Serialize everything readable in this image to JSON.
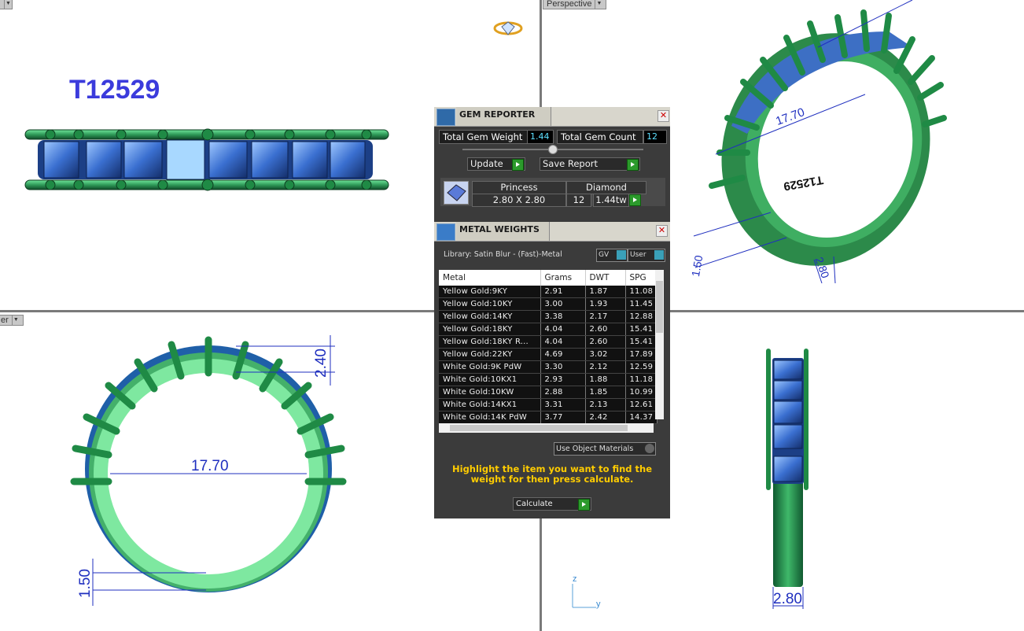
{
  "scene": {
    "model_code": "T12529",
    "perspective_label": "Perspective",
    "left_view_label": "er",
    "dimensions": {
      "d_2_40": "2.40",
      "d_17_70": "17.70",
      "d_1_50": "1.50",
      "d_2_80": "2.80",
      "d_2_80_side": "2.80",
      "d_17_70_persp": "17.70",
      "d_1_50_persp": "1.50",
      "d_code_mirror": "T12529"
    },
    "axis": {
      "z": "z",
      "y": "y"
    }
  },
  "gem_reporter": {
    "title": "GEM REPORTER",
    "total_weight_label": "Total Gem Weight",
    "total_weight_value": "1.44",
    "total_count_label": "Total Gem Count",
    "total_count_value": "12",
    "update_label": "Update",
    "save_report_label": "Save Report",
    "gem": {
      "shape": "Princess",
      "size": "2.80 X 2.80",
      "material": "Diamond",
      "count": "12",
      "weight": "1.44tw"
    }
  },
  "metal_weights": {
    "title": "METAL WEIGHTS",
    "library": "Library: Satin Blur - (Fast)-Metal",
    "toggle_gv": "GV",
    "toggle_user": "User",
    "columns": [
      "Metal",
      "Grams",
      "DWT",
      "SPG"
    ],
    "rows": [
      [
        "Yellow Gold:9KY",
        "2.91",
        "1.87",
        "11.08"
      ],
      [
        "Yellow Gold:10KY",
        "3.00",
        "1.93",
        "11.45"
      ],
      [
        "Yellow Gold:14KY",
        "3.38",
        "2.17",
        "12.88"
      ],
      [
        "Yellow Gold:18KY",
        "4.04",
        "2.60",
        "15.41"
      ],
      [
        "Yellow Gold:18KY R...",
        "4.04",
        "2.60",
        "15.41"
      ],
      [
        "Yellow Gold:22KY",
        "4.69",
        "3.02",
        "17.89"
      ],
      [
        "White Gold:9K PdW",
        "3.30",
        "2.12",
        "12.59"
      ],
      [
        "White Gold:10KX1",
        "2.93",
        "1.88",
        "11.18"
      ],
      [
        "White Gold:10KW",
        "2.88",
        "1.85",
        "10.99"
      ],
      [
        "White Gold:14KX1",
        "3.31",
        "2.13",
        "12.61"
      ],
      [
        "White Gold:14K PdW",
        "3.77",
        "2.42",
        "14.37"
      ]
    ],
    "use_object_materials": "Use Object Materials",
    "hint": "Highlight the item you want to find the weight for then press calculate.",
    "calculate_label": "Calculate"
  }
}
